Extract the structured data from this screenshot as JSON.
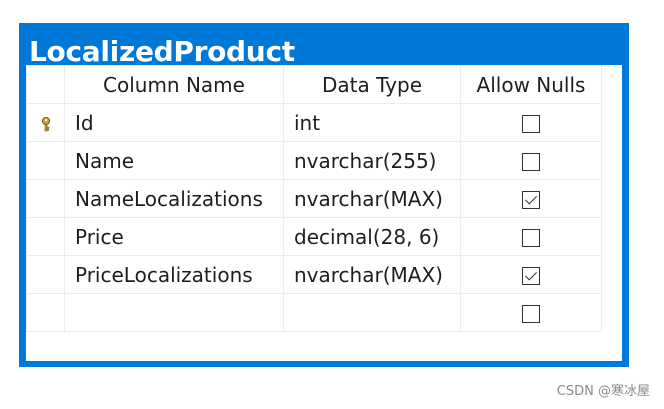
{
  "table": {
    "title": "LocalizedProduct",
    "headers": {
      "column_name": "Column Name",
      "data_type": "Data Type",
      "allow_nulls": "Allow Nulls"
    },
    "rows": [
      {
        "column_name": "Id",
        "data_type": "int",
        "allow_nulls": false,
        "primary_key": true
      },
      {
        "column_name": "Name",
        "data_type": "nvarchar(255)",
        "allow_nulls": false,
        "primary_key": false
      },
      {
        "column_name": "NameLocalizations",
        "data_type": "nvarchar(MAX)",
        "allow_nulls": true,
        "primary_key": false
      },
      {
        "column_name": "Price",
        "data_type": "decimal(28, 6)",
        "allow_nulls": false,
        "primary_key": false
      },
      {
        "column_name": "PriceLocalizations",
        "data_type": "nvarchar(MAX)",
        "allow_nulls": true,
        "primary_key": false
      },
      {
        "column_name": "",
        "data_type": "",
        "allow_nulls": false,
        "primary_key": false
      }
    ]
  },
  "icons": {
    "primary_key": "key-icon"
  },
  "colors": {
    "title_bar": "#0078d7",
    "title_text": "#ffffff",
    "key_icon": "#c9a227"
  },
  "watermark": "CSDN @寒冰屋"
}
